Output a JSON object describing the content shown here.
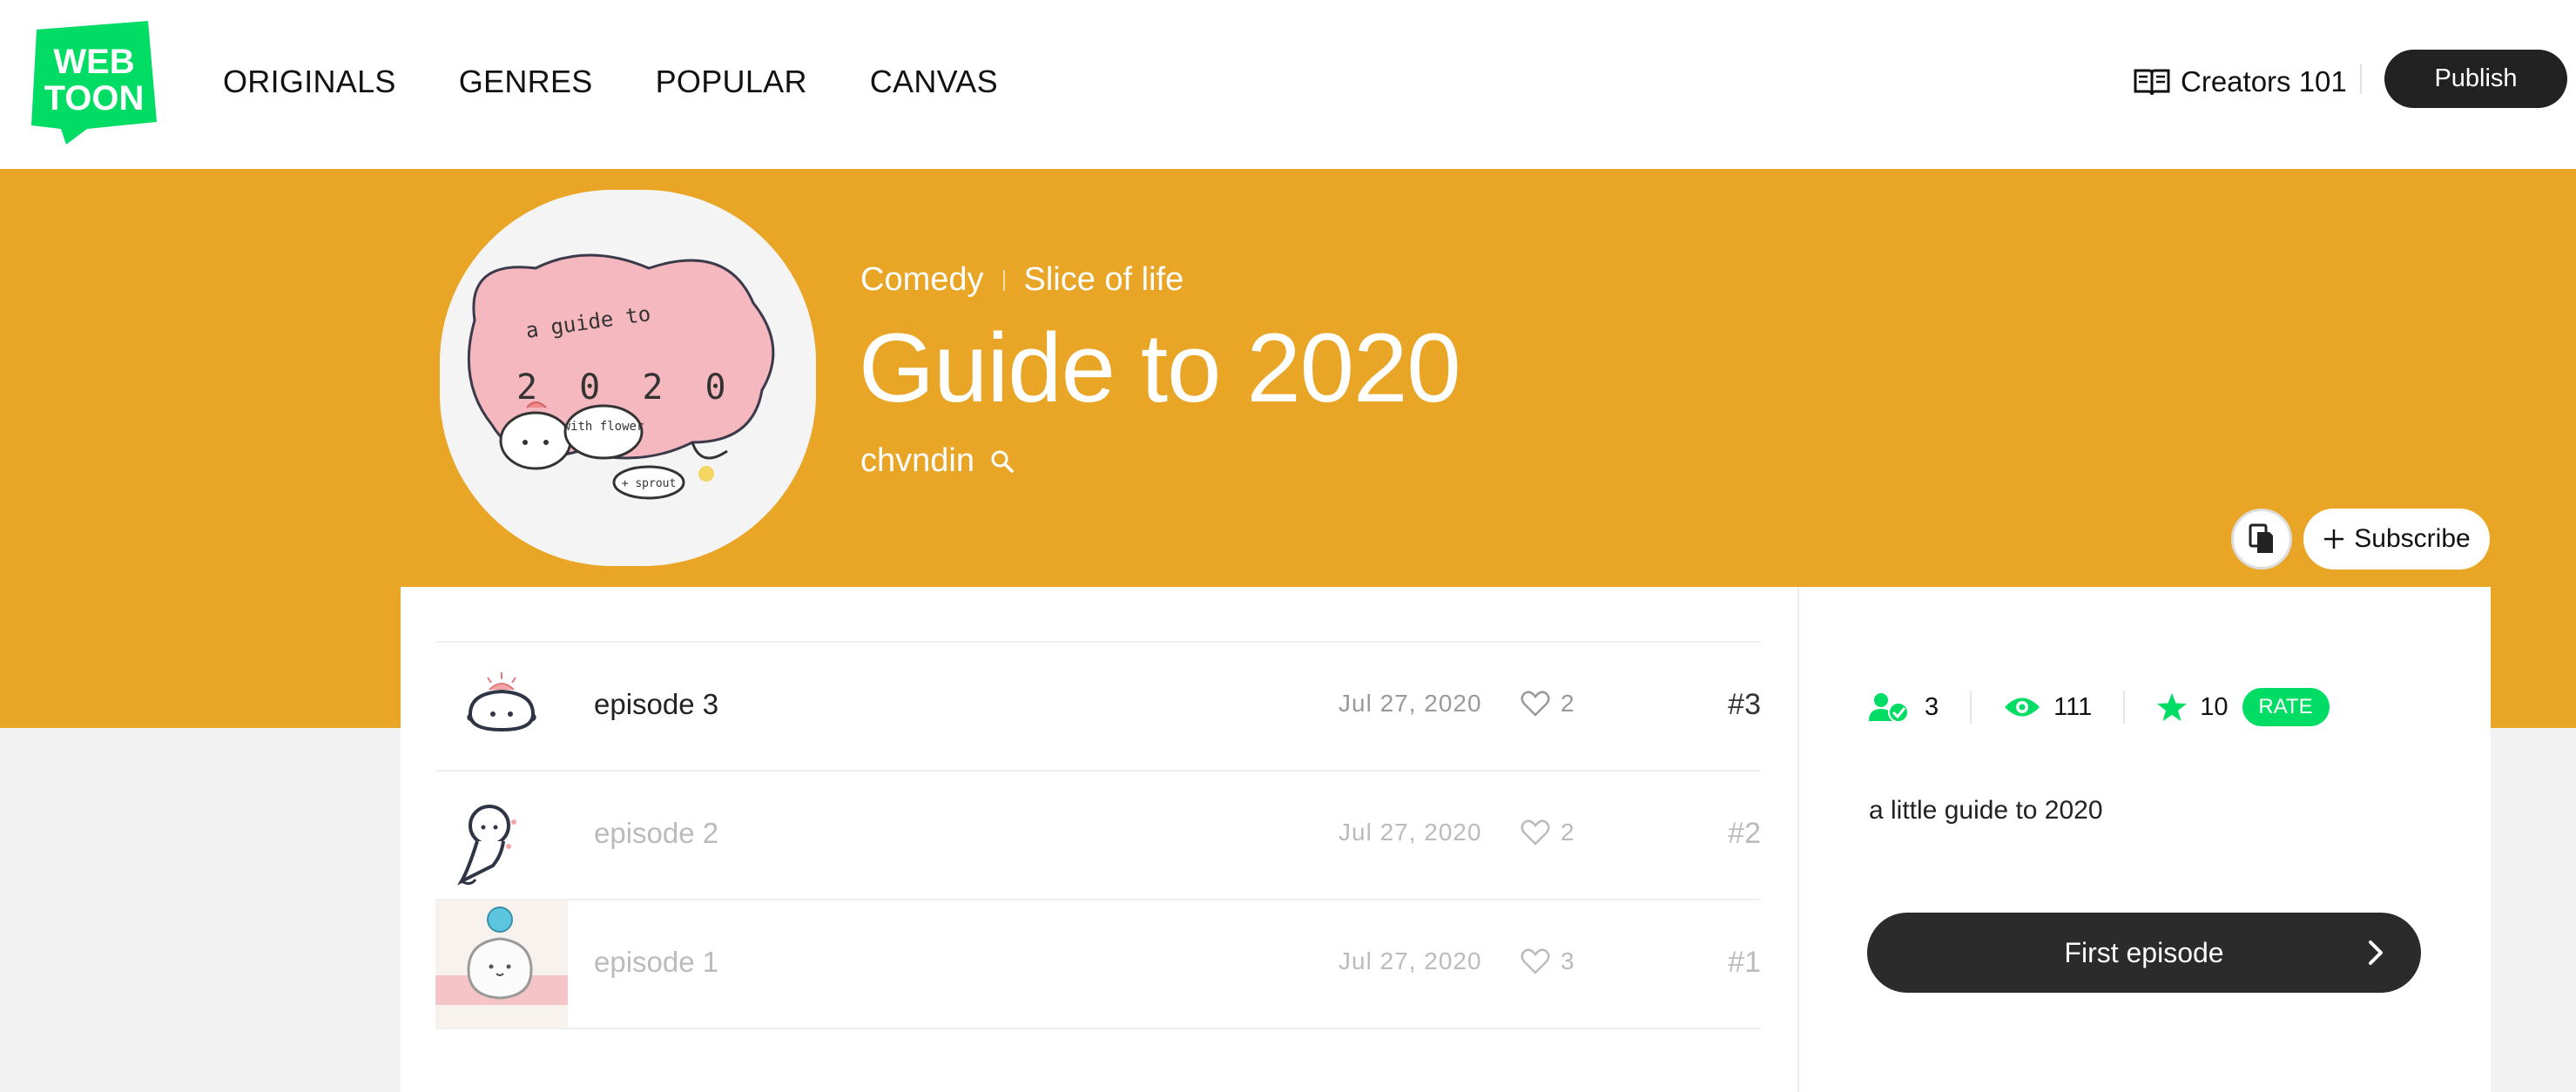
{
  "header": {
    "logo_text": "WEBTOON",
    "nav": [
      {
        "label": "ORIGINALS"
      },
      {
        "label": "GENRES"
      },
      {
        "label": "POPULAR"
      },
      {
        "label": "CANVAS"
      }
    ],
    "creators_label": "Creators 101",
    "publish_label": "Publish"
  },
  "series": {
    "genres": [
      "Comedy",
      "Slice of life"
    ],
    "title": "Guide to 2020",
    "author": "chvndin",
    "subscribe_label": "Subscribe",
    "summary": "a little guide to 2020",
    "first_episode_label": "First episode",
    "cover_text": [
      "a guide to",
      "2 0 2 0",
      "with flower",
      "+ sprout"
    ]
  },
  "stats": {
    "subscribers": "3",
    "views": "111",
    "rating": "10",
    "rate_label": "RATE"
  },
  "episodes": [
    {
      "title": "episode 3",
      "date": "Jul 27, 2020",
      "likes": "2",
      "number": "#3",
      "dimmed": false
    },
    {
      "title": "episode 2",
      "date": "Jul 27, 2020",
      "likes": "2",
      "number": "#2",
      "dimmed": true
    },
    {
      "title": "episode 1",
      "date": "Jul 27, 2020",
      "likes": "3",
      "number": "#1",
      "dimmed": true
    }
  ],
  "colors": {
    "banner": "#e9a526",
    "brand_green": "#00dc64",
    "dark_button": "#222222"
  },
  "icons": {
    "book": "book-icon",
    "search": "search-icon",
    "copy": "copy-icon",
    "plus": "plus-icon",
    "heart": "heart-icon",
    "subscribers": "subscribers-icon",
    "views": "eye-icon",
    "star": "star-icon",
    "chevron": "chevron-right-icon"
  }
}
